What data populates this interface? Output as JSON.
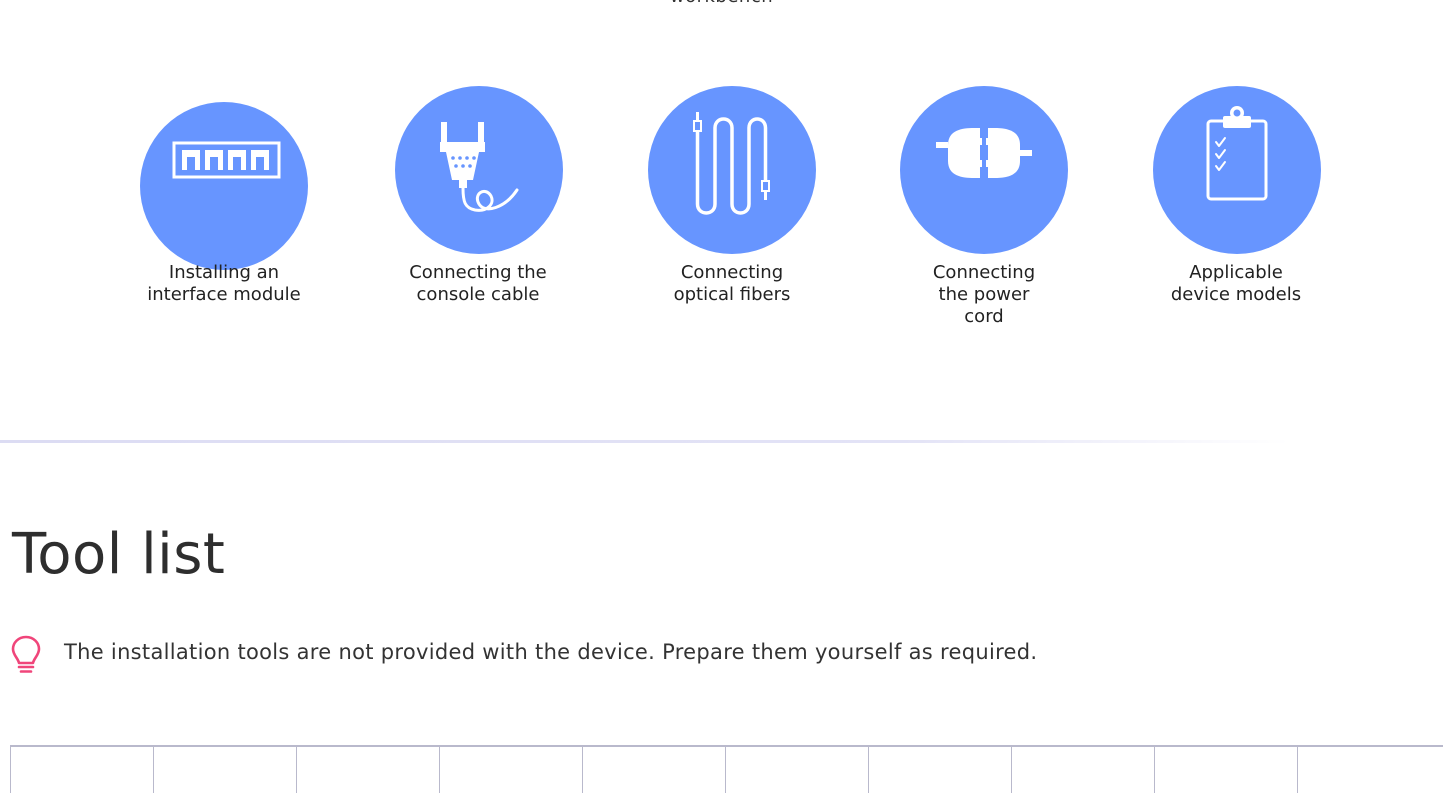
{
  "top_text": "workbench",
  "items": [
    {
      "label_lines": [
        "Installing an",
        "interface module"
      ],
      "icon": "interface-module-icon"
    },
    {
      "label_lines": [
        "Connecting the",
        "console cable"
      ],
      "icon": "console-cable-icon"
    },
    {
      "label_lines": [
        "Connecting",
        "optical fibers"
      ],
      "icon": "optical-fibers-icon"
    },
    {
      "label_lines": [
        "Connecting",
        "the power",
        "cord"
      ],
      "icon": "power-cord-icon"
    },
    {
      "label_lines": [
        "Applicable",
        "device models"
      ],
      "icon": "clipboard-checklist-icon"
    }
  ],
  "section_title": "Tool list",
  "note": {
    "icon": "lightbulb-icon",
    "text": "The installation tools are not provided with the device. Prepare them yourself as required."
  },
  "colors": {
    "circle": "#6795ff",
    "note_icon": "#f0457a",
    "divider": "#e3e3f6",
    "table_border": "#b9b9cc"
  },
  "table_column_count": 10
}
